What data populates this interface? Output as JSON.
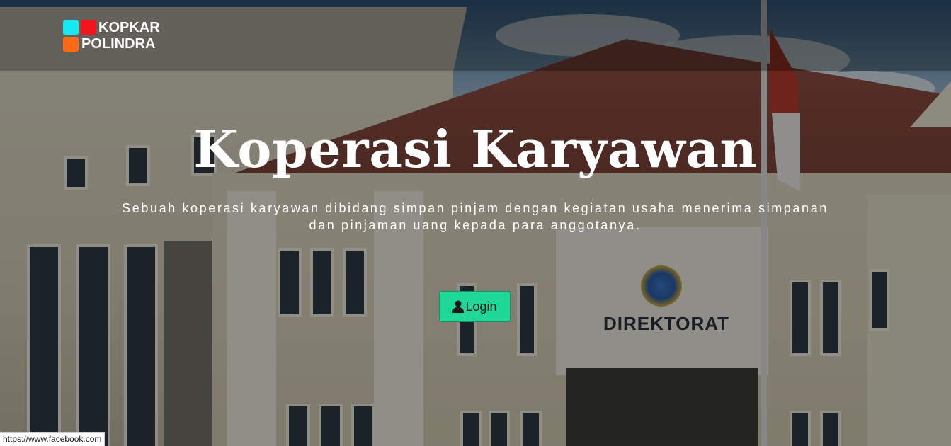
{
  "brand": {
    "line1": "KOPKAR",
    "line2": "POLINDRA",
    "colors": [
      "#17e8f2",
      "#f2161c",
      "#ff6b15"
    ]
  },
  "hero": {
    "title": "Koperasi Karyawan",
    "subtitle": "Sebuah koperasi karyawan dibidang simpan pinjam dengan kegiatan usaha menerima simpanan dan pinjaman uang kepada para anggotanya.",
    "background_sign": "DIREKTORAT"
  },
  "login_button": {
    "icon": "user-icon",
    "label": "Login",
    "color": "#1fd898"
  },
  "status_bar": {
    "url": "https://www.facebook.com"
  }
}
